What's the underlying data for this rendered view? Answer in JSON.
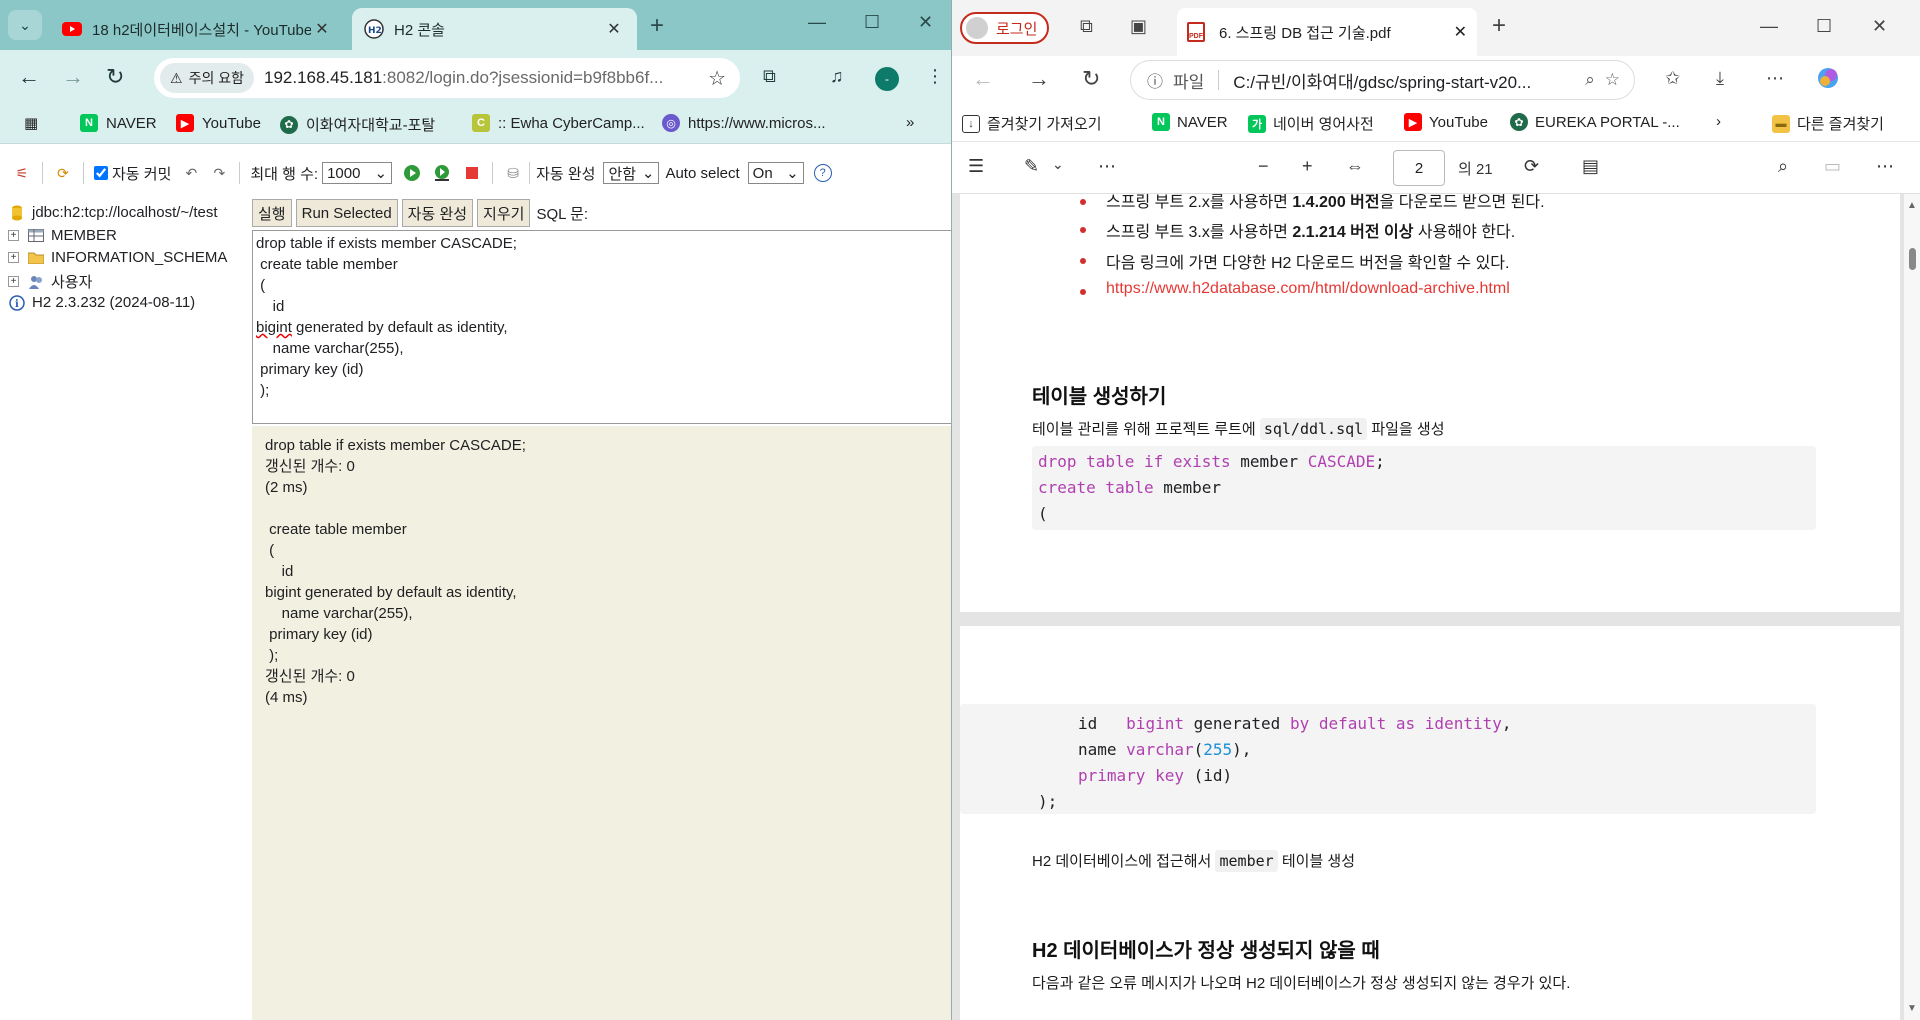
{
  "chrome": {
    "tabs": [
      {
        "title": "18 h2데이터베이스설치 - YouTube",
        "active": false
      },
      {
        "title": "H2 콘솔",
        "active": true
      }
    ],
    "security_label": "주의 요함",
    "url_host": "192.168.45.181",
    "url_rest": ":8082/login.do?jsessionid=b9f8bb6f...",
    "avatar_letter": "-",
    "bookmarks": [
      "NAVER",
      "YouTube",
      "이화여자대학교-포탈",
      ":: Ewha CyberCamp...",
      "https://www.micros..."
    ]
  },
  "h2": {
    "autocommit_label": "자동 커밋",
    "max_rows_label": "최대 행 수:",
    "max_rows_value": "1000",
    "autocomplete_label": "자동 완성",
    "autocomplete_value": "안함",
    "autoselect_label": "Auto select",
    "autoselect_value": "On",
    "tree": {
      "connection": "jdbc:h2:tcp://localhost/~/test",
      "items": [
        "MEMBER",
        "INFORMATION_SCHEMA",
        "사용자"
      ],
      "version": "H2 2.3.232 (2024-08-11)"
    },
    "buttons": {
      "run": "실행",
      "run_selected": "Run Selected",
      "autocomplete": "자동 완성",
      "clear": "지우기",
      "sql_label": "SQL 문:"
    },
    "sql_lines": [
      "drop table if exists member CASCADE;",
      " create table member",
      " (",
      "    id",
      "bigint generated by default as identity,",
      "    name varchar(255),",
      " primary key (id)",
      " );"
    ],
    "result_lines": [
      "drop table if exists member CASCADE;",
      "갱신된 개수: 0",
      "(2 ms)",
      "",
      " create table member",
      " (",
      "    id",
      "bigint generated by default as identity,",
      "    name varchar(255),",
      " primary key (id)",
      " );",
      "갱신된 개수: 0",
      "(4 ms)"
    ]
  },
  "edge": {
    "login_label": "로그인",
    "tab_title": "6. 스프링 DB 접근 기술.pdf",
    "file_label": "파일",
    "path": "C:/규빈/이화여대/gdsc/spring-start-v20...",
    "bookmarks": [
      "즐겨찾기 가져오기",
      "NAVER",
      "네이버 영어사전",
      "YouTube",
      "EUREKA PORTAL -...",
      "다른 즐겨찾기"
    ],
    "page_number": "2",
    "page_total": "의 21"
  },
  "pdf": {
    "bullet1_prefix": "스프링 부트 2.x를 사용하면 ",
    "bullet1_bold": "1.4.200 버전",
    "bullet1_suffix": "을 다운로드 받으면 된다.",
    "bullet2_prefix": "스프링 부트 3.x를 사용하면 ",
    "bullet2_bold": "2.1.214 버전 이상",
    "bullet2_suffix": " 사용해야 한다.",
    "bullet3": "다음 링크에 가면 다양한 H2 다운로드 버전을 확인할 수 있다.",
    "bullet4_link": "https://www.h2database.com/html/download-archive.html",
    "heading1": "테이블 생성하기",
    "para1_prefix": "테이블 관리를 위해 프로젝트 루트에 ",
    "para1_code": "sql/ddl.sql",
    "para1_suffix": " 파일을 생성",
    "para2_prefix": "H2 데이터베이스에 접근해서 ",
    "para2_code": "member",
    "para2_suffix": " 테이블 생성",
    "heading2": "H2 데이터베이스가 정상 생성되지 않을 때",
    "para3": "다음과 같은 오류 메시지가 나오며 H2 데이터베이스가 정상 생성되지 않는 경우가 있다."
  }
}
